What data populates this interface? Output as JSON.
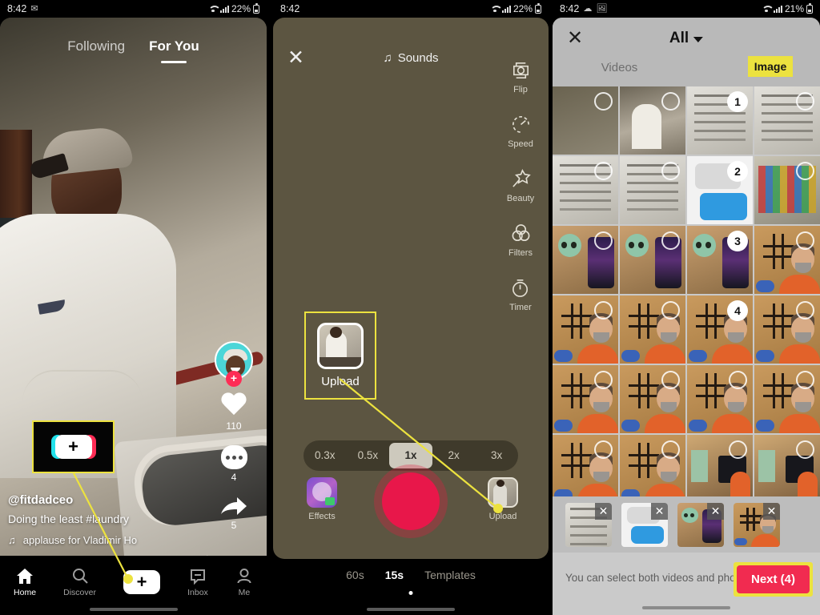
{
  "panels": {
    "feed": {
      "status": {
        "time": "8:42",
        "battery": "22%"
      },
      "tabs": [
        {
          "label": "Following",
          "active": false
        },
        {
          "label": "For You",
          "active": true
        }
      ],
      "caption": {
        "username": "@fitdadceo",
        "text": "Doing the least #laundry",
        "music": "applause for Vladimir Ho"
      },
      "rail": {
        "likes": "110",
        "comments": "4",
        "shares": "5"
      },
      "tabbar": [
        {
          "label": "Home",
          "icon": "home-icon"
        },
        {
          "label": "Discover",
          "icon": "search-icon"
        },
        {
          "label": "",
          "icon": "create-plus-icon"
        },
        {
          "label": "Inbox",
          "icon": "inbox-icon"
        },
        {
          "label": "Me",
          "icon": "person-icon"
        }
      ],
      "create_plus": "+",
      "highlight_create_plus": "+"
    },
    "camera": {
      "status": {
        "time": "8:42",
        "battery": "22%"
      },
      "close_label": "✕",
      "sounds_label": "Sounds",
      "rail": [
        {
          "label": "Flip",
          "icon": "flip-camera-icon"
        },
        {
          "label": "Speed",
          "icon": "speed-gauge-icon"
        },
        {
          "label": "Beauty",
          "icon": "beauty-wand-icon"
        },
        {
          "label": "Filters",
          "icon": "filters-circles-icon"
        },
        {
          "label": "Timer",
          "icon": "timer-icon"
        }
      ],
      "callout_upload_label": "Upload",
      "speeds": [
        {
          "label": "0.3x",
          "active": false
        },
        {
          "label": "0.5x",
          "active": false
        },
        {
          "label": "1x",
          "active": true
        },
        {
          "label": "2x",
          "active": false
        },
        {
          "label": "3x",
          "active": false
        }
      ],
      "effects_label": "Effects",
      "upload_label": "Upload",
      "modes": [
        {
          "label": "60s",
          "active": false
        },
        {
          "label": "15s",
          "active": true
        },
        {
          "label": "Templates",
          "active": false
        }
      ]
    },
    "gallery": {
      "status": {
        "time": "8:42",
        "battery": "21%"
      },
      "close_label": "✕",
      "album_label": "All",
      "tabs": [
        {
          "label": "Videos",
          "active": false,
          "highlighted": false
        },
        {
          "label": "Image",
          "active": true,
          "highlighted": true
        }
      ],
      "grid": [
        {
          "art": "art-olive",
          "selected": false,
          "badge": ""
        },
        {
          "art": "art-feed",
          "selected": false,
          "badge": ""
        },
        {
          "art": "art-doc",
          "selected": true,
          "badge": "1"
        },
        {
          "art": "art-doc",
          "selected": false,
          "badge": ""
        },
        {
          "art": "art-doc",
          "selected": false,
          "badge": ""
        },
        {
          "art": "art-doc",
          "selected": false,
          "badge": ""
        },
        {
          "art": "art-chat",
          "selected": true,
          "badge": "2"
        },
        {
          "art": "art-game",
          "selected": false,
          "badge": ""
        },
        {
          "art": "art-yoda",
          "selected": false,
          "badge": ""
        },
        {
          "art": "art-yoda",
          "selected": false,
          "badge": ""
        },
        {
          "art": "art-yoda",
          "selected": true,
          "badge": "3"
        },
        {
          "art": "art-ttt",
          "selected": false,
          "badge": ""
        },
        {
          "art": "art-ttt",
          "selected": false,
          "badge": ""
        },
        {
          "art": "art-ttt",
          "selected": false,
          "badge": ""
        },
        {
          "art": "art-ttt",
          "selected": true,
          "badge": "4"
        },
        {
          "art": "art-ttt",
          "selected": false,
          "badge": ""
        },
        {
          "art": "art-ttt",
          "selected": false,
          "badge": ""
        },
        {
          "art": "art-ttt",
          "selected": false,
          "badge": ""
        },
        {
          "art": "art-ttt",
          "selected": false,
          "badge": ""
        },
        {
          "art": "art-ttt",
          "selected": false,
          "badge": ""
        },
        {
          "art": "art-ttt",
          "selected": false,
          "badge": ""
        },
        {
          "art": "art-ttt",
          "selected": false,
          "badge": ""
        },
        {
          "art": "art-room",
          "selected": false,
          "badge": ""
        },
        {
          "art": "art-room",
          "selected": false,
          "badge": ""
        }
      ],
      "selected_strip": [
        {
          "art": "art-doc",
          "remove": "✕"
        },
        {
          "art": "art-chat",
          "remove": "✕"
        },
        {
          "art": "art-yoda",
          "remove": "✕"
        },
        {
          "art": "art-ttt",
          "remove": "✕"
        }
      ],
      "footer_hint": "You can select both videos and photos",
      "next_label": "Next (4)"
    }
  },
  "annotation": {
    "highlight_color": "#ece23f",
    "accent_red": "#fe2c55"
  }
}
